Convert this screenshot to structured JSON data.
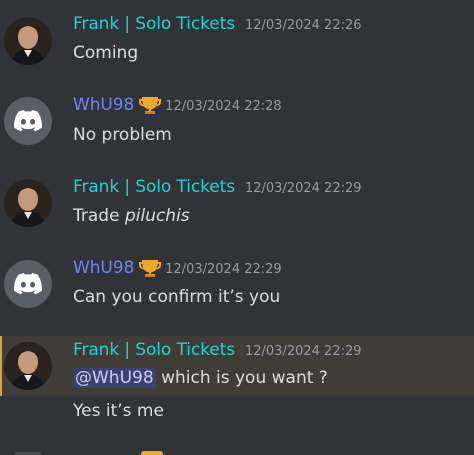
{
  "messages": [
    {
      "author": "Frank | Solo Tickets",
      "timestamp": "12/03/2024 22:26",
      "text": "Coming"
    },
    {
      "author": "WhU98",
      "badge_icon": "trophy-icon",
      "timestamp": "12/03/2024 22:28",
      "text": "No problem"
    },
    {
      "author": "Frank | Solo Tickets",
      "timestamp": "12/03/2024 22:29",
      "text_prefix": "Trade ",
      "text_italic": "piluchis"
    },
    {
      "author": "WhU98",
      "badge_icon": "trophy-icon",
      "timestamp": "12/03/2024 22:29",
      "text": "Can you confirm it’s you"
    },
    {
      "author": "Frank | Solo Tickets",
      "timestamp": "12/03/2024 22:29",
      "mention": "@WhU98",
      "text_after_mention": " which is you want ?"
    }
  ],
  "followup_message": {
    "text": "Yes it’s me"
  },
  "colors": {
    "background": "#313338",
    "frank_name": "#1cd5d2",
    "whu_name": "#6f83f0",
    "highlight_bg": "#403d38",
    "mention_bg": "#3c4270"
  }
}
